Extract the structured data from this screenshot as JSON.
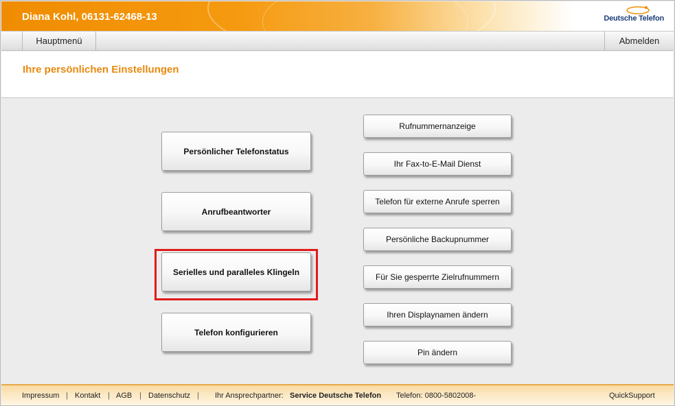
{
  "header": {
    "title": "Diana Kohl, 06131-62468-13",
    "logo_text": "Deutsche Telefon",
    "logo_icon": "orbit-logo-icon"
  },
  "nav": {
    "home_label": "Hauptmenü",
    "logout_label": "Abmelden"
  },
  "page": {
    "title": "Ihre persönlichen Einstellungen"
  },
  "left_buttons": [
    {
      "label": "Persönlicher Telefonstatus"
    },
    {
      "label": "Anrufbeantworter"
    },
    {
      "label": "Serielles und paralleles Klingeln",
      "highlighted": true
    },
    {
      "label": "Telefon konfigurieren"
    }
  ],
  "right_buttons": [
    {
      "label": "Rufnummernanzeige"
    },
    {
      "label": "Ihr Fax-to-E-Mail Dienst"
    },
    {
      "label": "Telefon für externe Anrufe sperren"
    },
    {
      "label": "Persönliche Backupnummer"
    },
    {
      "label": "Für Sie gesperrte Zielrufnummern"
    },
    {
      "label": "Ihren Displaynamen ändern"
    },
    {
      "label": "Pin ändern"
    }
  ],
  "footer": {
    "impressum": "Impressum",
    "kontakt": "Kontakt",
    "agb": "AGB",
    "datenschutz": "Datenschutz",
    "separator": "|",
    "partner_label": "Ihr Ansprechpartner:",
    "partner_name": "Service Deutsche Telefon",
    "phone": "Telefon: 0800-5802008-",
    "quicksupport": "QuickSupport"
  },
  "colors": {
    "accent_orange": "#f08c00",
    "title_orange": "#e8890f",
    "highlight_red": "#e01a1a",
    "logo_blue": "#1c3e7a"
  }
}
